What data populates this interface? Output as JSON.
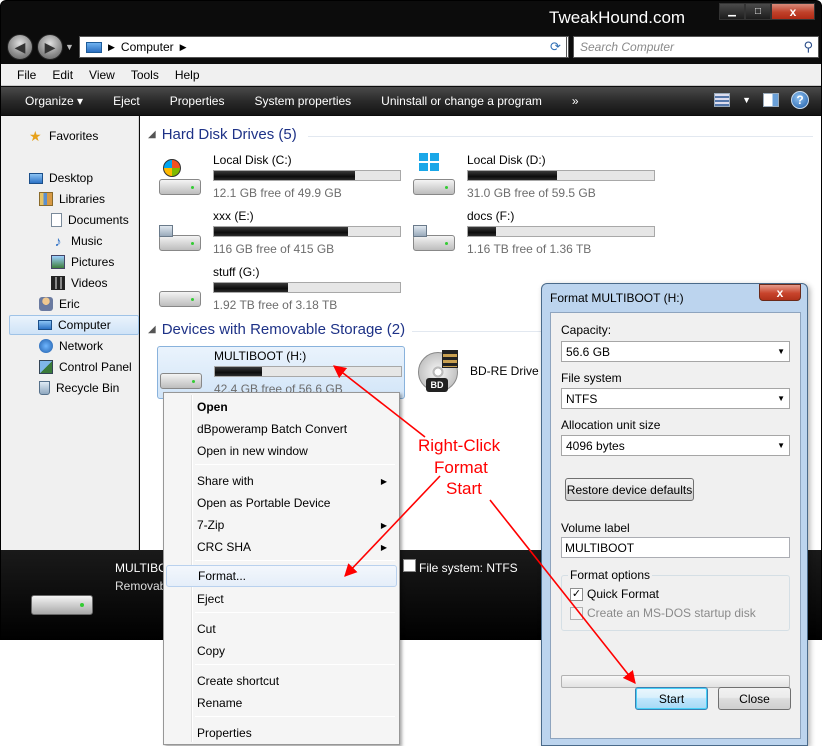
{
  "window": {
    "brand": "TweakHound.com"
  },
  "address": {
    "path": "Computer",
    "search_placeholder": "Search Computer"
  },
  "menubar": [
    "File",
    "Edit",
    "View",
    "Tools",
    "Help"
  ],
  "toolbar": {
    "organize": "Organize ▾",
    "eject": "Eject",
    "properties": "Properties",
    "system_properties": "System properties",
    "uninstall": "Uninstall or change a program",
    "more": "»",
    "help": "?"
  },
  "nav": {
    "favorites": "Favorites",
    "desktop": "Desktop",
    "libraries": "Libraries",
    "documents": "Documents",
    "music": "Music",
    "pictures": "Pictures",
    "videos": "Videos",
    "eric": "Eric",
    "computer": "Computer",
    "network": "Network",
    "control_panel": "Control Panel",
    "recycle_bin": "Recycle Bin"
  },
  "groups": {
    "hdd": "Hard Disk Drives (5)",
    "removable": "Devices with Removable Storage (2)"
  },
  "drives": {
    "c": {
      "name": "Local Disk (C:)",
      "free": "12.1 GB free of 49.9 GB",
      "used_fraction": 0.76
    },
    "d": {
      "name": "Local Disk (D:)",
      "free": "31.0 GB free of 59.5 GB",
      "used_fraction": 0.48
    },
    "e": {
      "name": "xxx (E:)",
      "free": "116 GB free of 415 GB",
      "used_fraction": 0.72
    },
    "f": {
      "name": "docs (F:)",
      "free": "1.16 TB free of 1.36 TB",
      "used_fraction": 0.15
    },
    "g": {
      "name": "stuff (G:)",
      "free": "1.92 TB free of 3.18 TB",
      "used_fraction": 0.4
    },
    "h": {
      "name": "MULTIBOOT (H:)",
      "free": "42.4 GB free of 56.6 GB",
      "used_fraction": 0.25
    },
    "bd": {
      "name": "BD-RE Drive (K",
      "badge": "BD"
    }
  },
  "details": {
    "name": "MULTIBO",
    "type": "Removab",
    "fs": "File system:  NTFS"
  },
  "context_menu": {
    "open": "Open",
    "dbpoweramp": "dBpoweramp Batch Convert",
    "open_new_window": "Open in new window",
    "share_with": "Share with",
    "open_portable": "Open as Portable Device",
    "zip": "7-Zip",
    "crc": "CRC SHA",
    "format": "Format...",
    "eject": "Eject",
    "cut": "Cut",
    "copy": "Copy",
    "create_shortcut": "Create shortcut",
    "rename": "Rename",
    "properties": "Properties"
  },
  "format_dialog": {
    "title": "Format MULTIBOOT (H:)",
    "close": "x",
    "capacity_label": "Capacity:",
    "capacity_value": "56.6 GB",
    "fs_label": "File system",
    "fs_value": "NTFS",
    "alloc_label": "Allocation unit size",
    "alloc_value": "4096 bytes",
    "restore": "Restore device defaults",
    "volume_label": "Volume label",
    "volume_value": "MULTIBOOT",
    "options_label": "Format options",
    "quick_format": "Quick Format",
    "quick_format_checked": true,
    "msdos": "Create an MS-DOS startup disk",
    "progress": 0,
    "start": "Start",
    "close_btn": "Close"
  },
  "annotation": {
    "line1": "Right-Click",
    "line2": "Format",
    "line3": "Start"
  },
  "colors": {
    "annotation": "#ff0000",
    "group_heading": "#1e3287"
  }
}
